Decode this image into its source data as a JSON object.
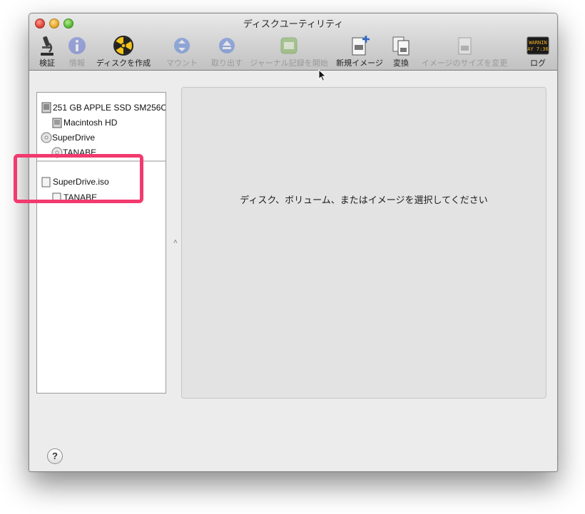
{
  "window": {
    "title": "ディスクユーティリティ"
  },
  "toolbar": {
    "items": [
      {
        "label": "検証",
        "icon": "microscope-icon",
        "enabled": true
      },
      {
        "label": "情報",
        "icon": "info-icon",
        "enabled": false
      },
      {
        "label": "ディスクを作成",
        "icon": "burn-icon",
        "enabled": true
      },
      {
        "label": "マウント",
        "icon": "mount-icon",
        "enabled": false
      },
      {
        "label": "取り出す",
        "icon": "eject-icon",
        "enabled": false
      },
      {
        "label": "ジャーナル記録を開始",
        "icon": "journal-icon",
        "enabled": false
      },
      {
        "label": "新規イメージ",
        "icon": "new-image-icon",
        "enabled": true
      },
      {
        "label": "変換",
        "icon": "convert-icon",
        "enabled": true
      },
      {
        "label": "イメージのサイズを変更",
        "icon": "resize-image-icon",
        "enabled": false
      },
      {
        "label": "ログ",
        "icon": "log-icon",
        "enabled": true
      }
    ],
    "log_icon_text": [
      "WARNIN",
      "AY 7:36"
    ]
  },
  "sidebar": {
    "devices": [
      {
        "label": "251 GB APPLE SSD SM256C",
        "icon": "internal-disk-icon",
        "level": 0
      },
      {
        "label": "Macintosh HD",
        "icon": "volume-icon",
        "level": 1
      },
      {
        "label": "SuperDrive",
        "icon": "optical-drive-icon",
        "level": 0
      },
      {
        "label": "TANABE",
        "icon": "optical-disc-icon",
        "level": 1
      }
    ],
    "images": [
      {
        "label": "SuperDrive.iso",
        "icon": "disk-image-icon",
        "level": 0
      },
      {
        "label": "TANABE",
        "icon": "disk-image-volume-icon",
        "level": 1
      }
    ]
  },
  "main": {
    "message": "ディスク、ボリューム、またはイメージを選択してください"
  },
  "help": {
    "label": "?"
  },
  "colors": {
    "highlight": "#f23a6e",
    "window_bg": "#ececec"
  }
}
